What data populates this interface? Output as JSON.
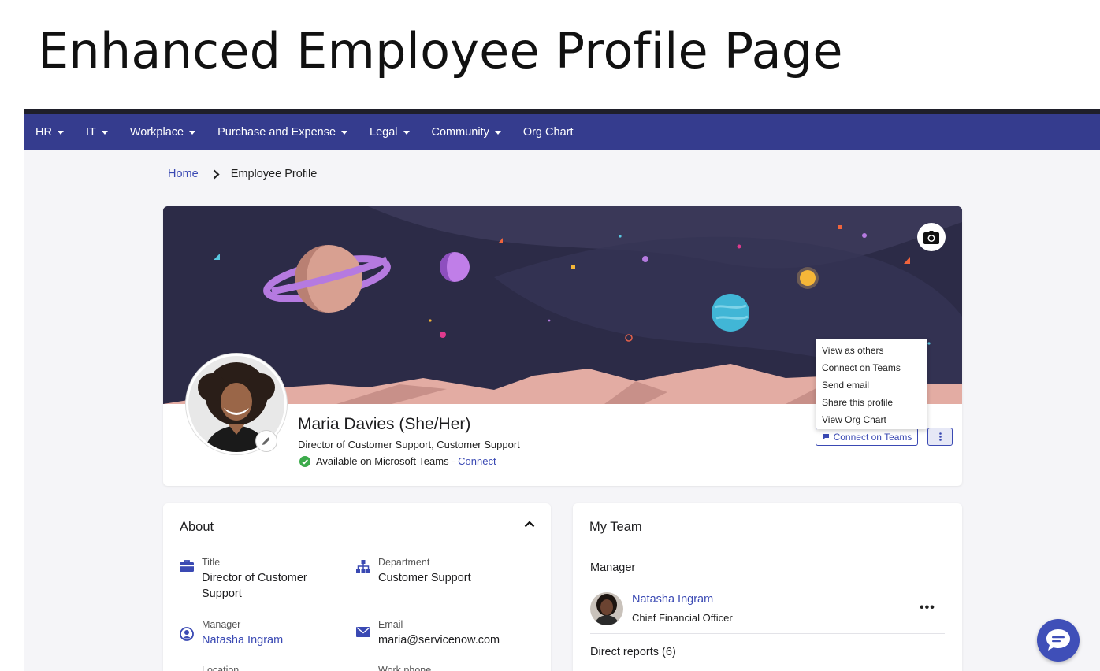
{
  "slide": {
    "title": "Enhanced Employee Profile Page"
  },
  "nav": {
    "items": [
      {
        "label": "HR",
        "dropdown": true
      },
      {
        "label": "IT",
        "dropdown": true
      },
      {
        "label": "Workplace",
        "dropdown": true
      },
      {
        "label": "Purchase and Expense",
        "dropdown": true
      },
      {
        "label": "Legal",
        "dropdown": true
      },
      {
        "label": "Community",
        "dropdown": true
      },
      {
        "label": "Org Chart",
        "dropdown": false
      }
    ]
  },
  "breadcrumb": {
    "home": "Home",
    "current": "Employee Profile"
  },
  "profile": {
    "name": "Maria Davies (She/Her)",
    "title": "Director of Customer Support, Customer Support",
    "status_text": "Available on Microsoft Teams - ",
    "status_link": "Connect",
    "teams_button": "Connect on Teams"
  },
  "menu": {
    "items": [
      "View as others",
      "Connect on Teams",
      "Send email",
      "Share this profile",
      "View Org Chart"
    ]
  },
  "about": {
    "heading": "About",
    "fields": {
      "title": {
        "label": "Title",
        "value_line1": "Director of Customer",
        "value_line2": "Support"
      },
      "department": {
        "label": "Department",
        "value": "Customer Support"
      },
      "manager": {
        "label": "Manager",
        "value": "Natasha Ingram"
      },
      "email": {
        "label": "Email",
        "value": "maria@servicenow.com"
      },
      "location": {
        "label": "Location"
      },
      "work_phone": {
        "label": "Work phone"
      }
    }
  },
  "team": {
    "heading": "My Team",
    "manager_label": "Manager",
    "manager": {
      "name": "Natasha Ingram",
      "role": "Chief Financial Officer",
      "more": "•••"
    },
    "direct_reports": "Direct reports (6)"
  },
  "colors": {
    "nav": "#353c8e",
    "accent": "#3a49b3",
    "banner": "#2c2b47"
  }
}
